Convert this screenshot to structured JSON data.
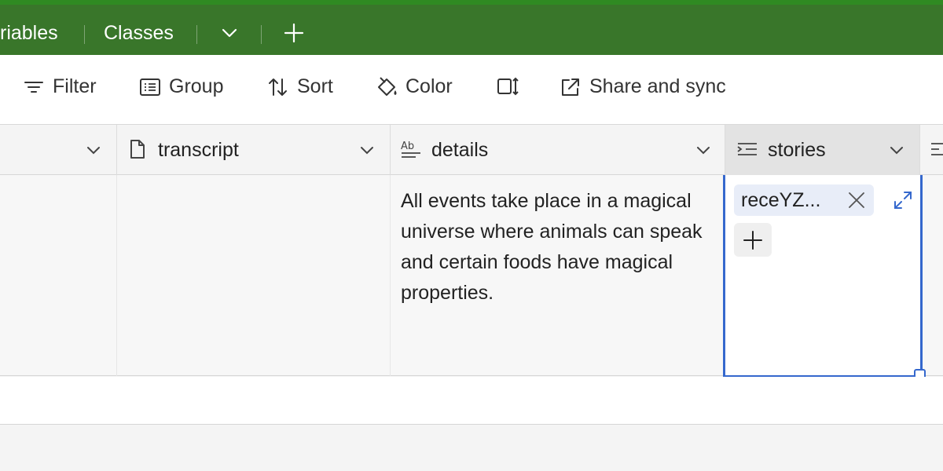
{
  "tabs": {
    "variables_partial": "riables",
    "classes": "Classes"
  },
  "toolbar": {
    "filter": "Filter",
    "group": "Group",
    "sort": "Sort",
    "color": "Color",
    "share": "Share and sync"
  },
  "columns": {
    "col0_partial": "",
    "transcript": "transcript",
    "details": "details",
    "stories": "stories"
  },
  "row": {
    "details": "All events take place in a magical universe where animals can speak and certain foods have magical properties.",
    "stories_chip": "receYZ..."
  },
  "colors": {
    "tabbar": "#39762a",
    "selection": "#3568cd",
    "chip": "#e8edf8"
  },
  "icons": [
    "chevron-down-icon",
    "plus-icon",
    "filter-icon",
    "group-icon",
    "sort-icon",
    "color-icon",
    "row-height-icon",
    "share-icon",
    "document-icon",
    "long-text-icon",
    "linked-record-icon",
    "close-icon",
    "expand-icon"
  ]
}
